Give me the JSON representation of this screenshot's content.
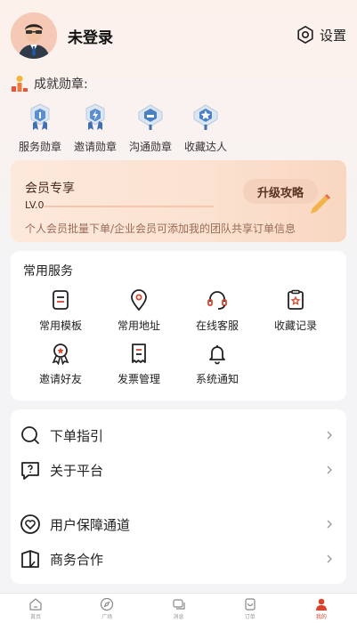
{
  "colors": {
    "accent": "#d9452b",
    "vip_text": "#4a2a1d",
    "vip_desc": "#9a6b56"
  },
  "user": {
    "name": "未登录",
    "avatar_icon": "user-avatar-icon"
  },
  "settings": {
    "label": "设置",
    "icon": "gear-icon"
  },
  "achievements": {
    "title": "成就勋章:",
    "badges": [
      {
        "label": "服务勋章",
        "icon": "medal-icon"
      },
      {
        "label": "邀请勋章",
        "icon": "medal-icon"
      },
      {
        "label": "沟通勋章",
        "icon": "medal-icon"
      },
      {
        "label": "收藏达人",
        "icon": "medal-icon"
      }
    ]
  },
  "vip": {
    "title": "会员专享",
    "level": "LV.0",
    "progress": 0,
    "upgrade_label": "升级攻略",
    "description": "个人会员批量下单/企业会员可添加我的团队共享订单信息"
  },
  "services": {
    "title": "常用服务",
    "items": [
      {
        "label": "常用模板",
        "icon": "template-icon"
      },
      {
        "label": "常用地址",
        "icon": "location-icon"
      },
      {
        "label": "在线客服",
        "icon": "headset-icon"
      },
      {
        "label": "收藏记录",
        "icon": "favorites-icon"
      },
      {
        "label": "邀请好友",
        "icon": "invite-icon"
      },
      {
        "label": "发票管理",
        "icon": "invoice-icon"
      },
      {
        "label": "系统通知",
        "icon": "bell-icon"
      }
    ]
  },
  "menu": {
    "items": [
      {
        "label": "下单指引",
        "icon": "search-icon"
      },
      {
        "label": "关于平台",
        "icon": "question-icon"
      },
      {
        "label": "用户保障通道",
        "icon": "heart-shield-icon"
      },
      {
        "label": "商务合作",
        "icon": "book-icon"
      }
    ]
  },
  "tabbar": {
    "items": [
      {
        "label": "首页",
        "icon": "home-icon",
        "active": false
      },
      {
        "label": "广场",
        "icon": "compass-icon",
        "active": false
      },
      {
        "label": "消息",
        "icon": "message-icon",
        "active": false
      },
      {
        "label": "订单",
        "icon": "order-icon",
        "active": false
      },
      {
        "label": "我的",
        "icon": "profile-icon",
        "active": true
      }
    ]
  }
}
